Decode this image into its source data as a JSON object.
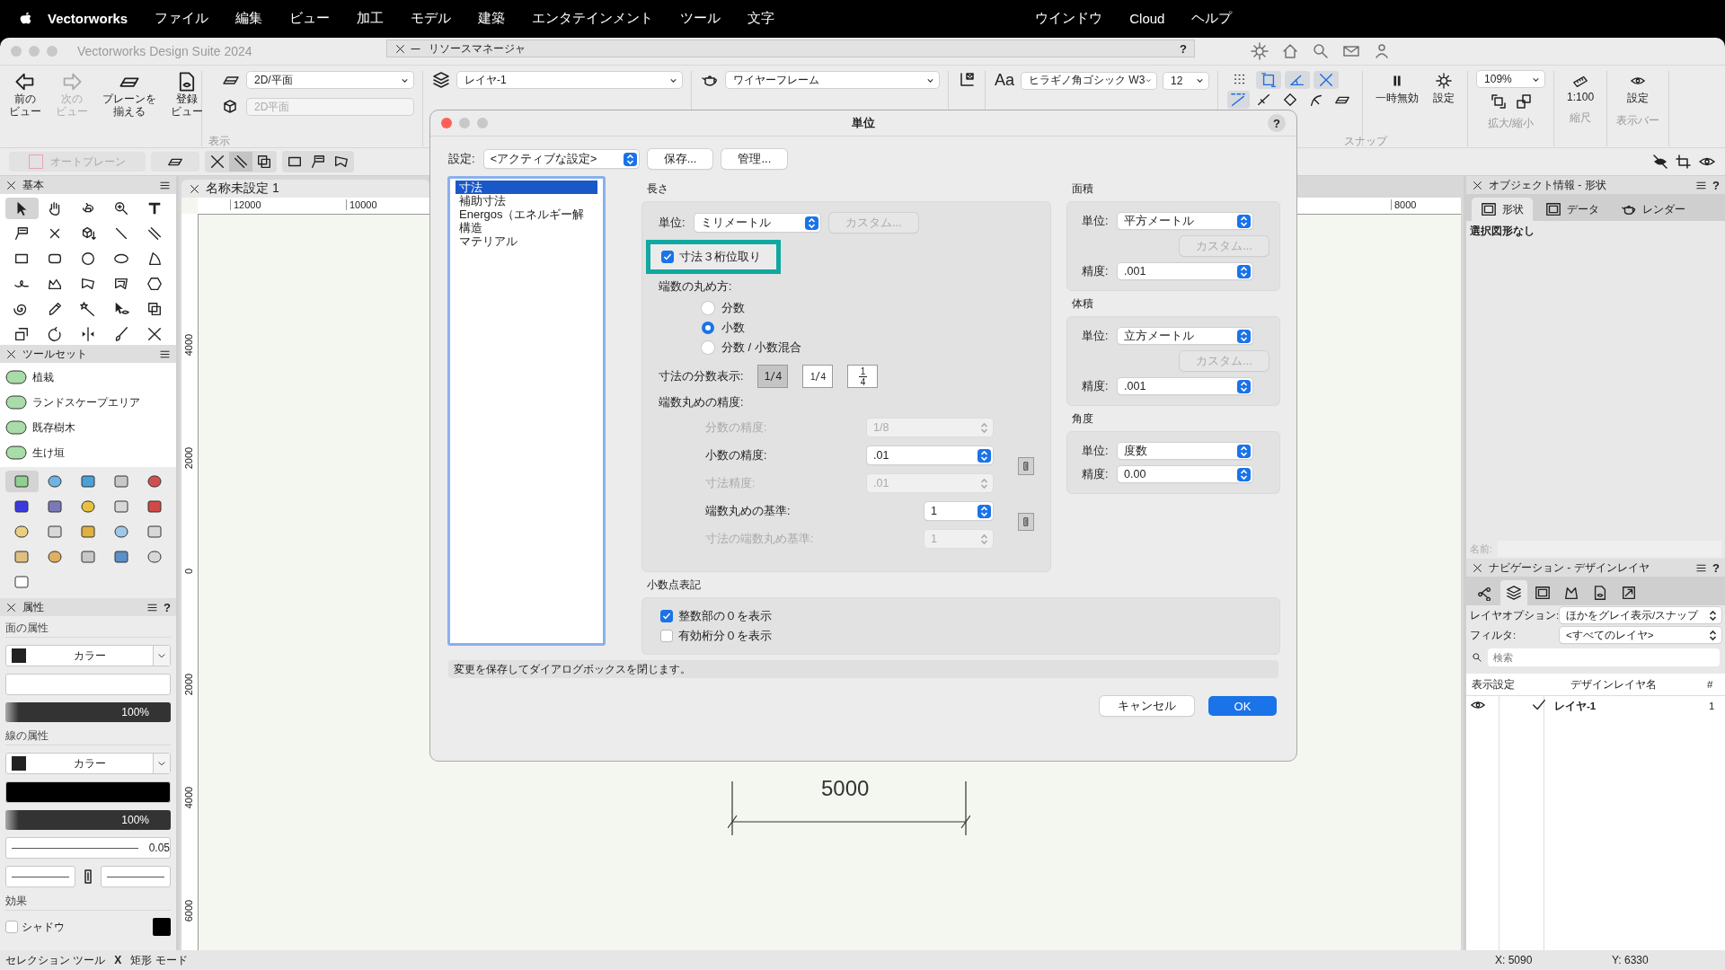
{
  "menubar": {
    "app": "Vectorworks",
    "menus": [
      "ファイル",
      "編集",
      "ビュー",
      "加工",
      "モデル",
      "建築",
      "エンタテインメント",
      "ツール",
      "文字"
    ],
    "right_menus": [
      "ウインドウ",
      "Cloud",
      "ヘルプ"
    ]
  },
  "window": {
    "title": "Vectorworks Design Suite 2024"
  },
  "resource_manager": {
    "title": "リソースマネージャ",
    "help": "?"
  },
  "toolbar": {
    "view_buttons": [
      {
        "line1": "前の",
        "line2": "ビュー",
        "disabled": false
      },
      {
        "line1": "次の",
        "line2": "ビュー",
        "disabled": true
      },
      {
        "line1": "プレーンを",
        "line2": "揃える",
        "disabled": false
      },
      {
        "line1": "登録",
        "line2": "ビュー",
        "disabled": false
      }
    ],
    "view_group_label": "表示",
    "plane": "2D/平面",
    "plane_2": "2D平面",
    "layer": "レイヤ-1",
    "render": "ワイヤーフレーム",
    "font_style": "Aa",
    "font": "ヒラギノ角ゴシック W3",
    "font_size": "12",
    "snaps": [
      {
        "kind": "grid",
        "selected": false
      },
      {
        "kind": "box",
        "selected": true
      },
      {
        "kind": "angle",
        "selected": true
      },
      {
        "kind": "cross",
        "selected": true
      }
    ],
    "snaps_2": [
      {
        "kind": "dash",
        "selected": true
      },
      {
        "kind": "tangent",
        "selected": false
      },
      {
        "kind": "fill",
        "selected": false
      },
      {
        "kind": "curve",
        "selected": false
      },
      {
        "kind": "plane",
        "selected": false
      }
    ],
    "snap_label": "スナップ",
    "pause": "一時無効",
    "snap_settings": "設定",
    "zoom": "109%",
    "zoom_label": "拡大/縮小",
    "scale": "1:100",
    "scale_label": "縮尺",
    "view_settings": "設定",
    "viewbar_label": "表示バー",
    "auto_plane": "オートプレーン"
  },
  "basic_palette": {
    "title": "基本"
  },
  "toolset_palette": {
    "title": "ツールセット",
    "items": [
      "植栽",
      "ランドスケープエリア",
      "既存樹木",
      "生け垣"
    ]
  },
  "attributes": {
    "title": "属性",
    "help": "?",
    "fill_label": "面の属性",
    "fill_type": "カラー",
    "fill_opacity": {
      "reading": "100%",
      "level": 1
    },
    "pen_label": "線の属性",
    "pen_type": "カラー",
    "pen_opacity": {
      "reading": "100%",
      "level": 1
    },
    "line_weight": "0.05",
    "effects_label": "効果",
    "shadow": {
      "label": "シャドウ",
      "checked": false
    }
  },
  "drawing": {
    "tab": "名称未設定 1",
    "top_ruler": [
      "12000",
      "10000",
      "8000"
    ],
    "side_ruler": [
      "4000",
      "2000",
      "0",
      "2000",
      "4000",
      "6000"
    ],
    "dimension": "5000"
  },
  "object_info": {
    "title": "オブジェクト情報 - 形状",
    "help": "?",
    "tabs": [
      {
        "label": "形状",
        "selected": true
      },
      {
        "label": "データ",
        "selected": false
      },
      {
        "label": "レンダー",
        "selected": false
      }
    ],
    "message": "選択図形なし",
    "name_label": "名前:"
  },
  "navigation": {
    "title": "ナビゲーション - デザインレイヤ",
    "help": "?",
    "tabs": [
      {
        "kind": "network",
        "selected": false
      },
      {
        "kind": "stack",
        "selected": true
      },
      {
        "kind": "frame",
        "selected": false
      },
      {
        "kind": "shapes",
        "selected": false
      },
      {
        "kind": "doc",
        "selected": false
      },
      {
        "kind": "ref",
        "selected": false
      }
    ],
    "layer_options_label": "レイヤオプション:",
    "layer_options": "ほかをグレイ表示/スナップ",
    "filter_label": "フィルタ:",
    "filter": "<すべてのレイヤ>",
    "search_placeholder": "検索",
    "columns": [
      "表示設定",
      "デザインレイヤ名",
      "#"
    ],
    "rows": [
      {
        "visible": true,
        "active": true,
        "name": "レイヤ-1",
        "number": "1"
      }
    ]
  },
  "status_bar": {
    "tool": "セレクション ツール",
    "separator": "X",
    "mode": "矩形 モード",
    "x": "X: 5090",
    "y": "Y: 6330"
  },
  "dialog": {
    "title": "単位",
    "help": "?",
    "settings_label": "設定:",
    "settings": "<アクティブな設定>",
    "save": "保存...",
    "manage": "管理...",
    "categories": [
      {
        "label": "寸法",
        "selected": true
      },
      {
        "label": "補助寸法",
        "selected": false
      },
      {
        "label": "Energos（エネルギー解",
        "selected": false
      },
      {
        "label": "構造",
        "selected": false
      },
      {
        "label": "マテリアル",
        "selected": false
      }
    ],
    "length": {
      "title": "長さ",
      "unit_label": "単位:",
      "unit": "ミリメートル",
      "custom": "カスタム...",
      "highlight_check": {
        "label": "寸法３桁位取り",
        "checked": true
      },
      "rounding_label": "端数の丸め方:",
      "rounding": [
        {
          "label": "分数",
          "selected": false
        },
        {
          "label": "小数",
          "selected": true
        },
        {
          "label": "分数 / 小数混合",
          "selected": false
        }
      ],
      "fraction_label": "寸法の分数表示:",
      "fractions": [
        {
          "kind": "inline",
          "numerator": "1",
          "denominator": "4",
          "selected": true
        },
        {
          "kind": "diagonal",
          "numerator": "1",
          "denominator": "4",
          "selected": false
        },
        {
          "kind": "stacked",
          "numerator": "1",
          "denominator": "4",
          "selected": false
        }
      ],
      "precision_label": "端数丸めの精度:",
      "precisions": [
        {
          "label": "分数の精度:",
          "value": "1/8",
          "disabled": true,
          "kind": "wide"
        },
        {
          "label": "小数の精度:",
          "value": ".01",
          "disabled": false,
          "kind": "wide"
        },
        {
          "label": "寸法精度:",
          "value": ".01",
          "disabled": true,
          "kind": "wide"
        },
        {
          "label": "端数丸めの基準:",
          "value": "1",
          "disabled": false,
          "kind": "narrow"
        },
        {
          "label": "寸法の端数丸め基準:",
          "value": "1",
          "disabled": true,
          "kind": "narrow"
        }
      ]
    },
    "area": {
      "title": "面積",
      "unit_label": "単位:",
      "unit": "平方メートル",
      "custom": "カスタム...",
      "precision_label": "精度:",
      "precision": ".001"
    },
    "volume": {
      "title": "体積",
      "unit_label": "単位:",
      "unit": "立方メートル",
      "custom": "カスタム...",
      "precision_label": "精度:",
      "precision": ".001"
    },
    "angle": {
      "title": "角度",
      "unit_label": "単位:",
      "unit": "度数",
      "precision_label": "精度:",
      "precision": "0.00"
    },
    "decimal": {
      "title": "小数点表記",
      "checks": [
        {
          "label": "整数部の０を表示",
          "checked": true
        },
        {
          "label": "有効桁分０を表示",
          "checked": false
        }
      ]
    },
    "help_text": "変更を保存してダイアログボックスを閉じます。",
    "cancel": "キャンセル",
    "ok": "OK"
  }
}
